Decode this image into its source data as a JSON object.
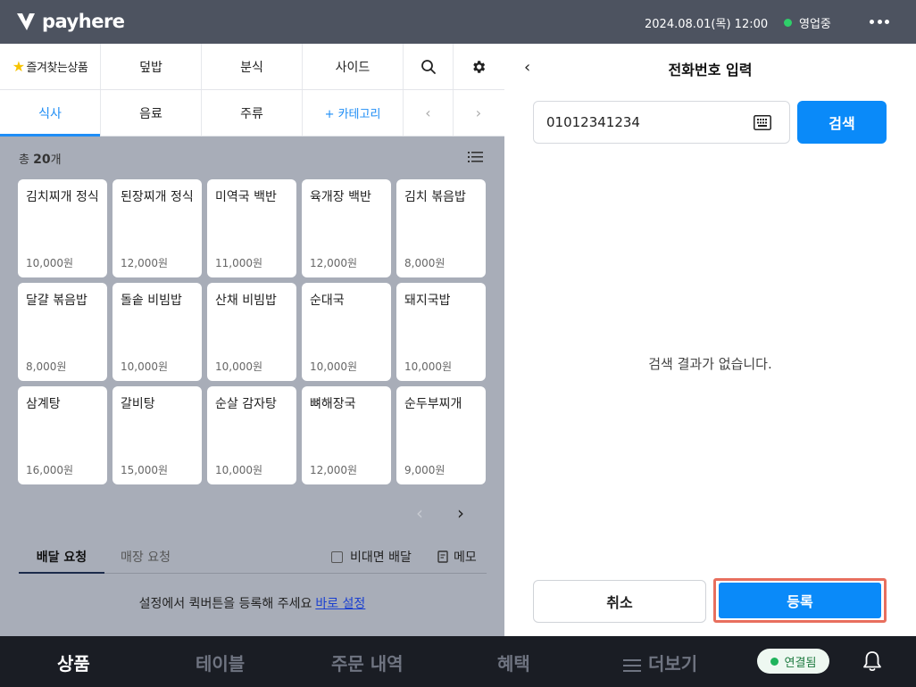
{
  "topbar": {
    "logo_text": "payhere",
    "datetime": "2024.08.01(목) 12:00",
    "status": "영업중",
    "status_color": "#2fcf6a",
    "more_icon": "more-horizontal-icon"
  },
  "categories": {
    "row1": [
      {
        "label": "즐겨찾는상품",
        "icon": "star-icon"
      },
      {
        "label": "덮밥"
      },
      {
        "label": "분식"
      },
      {
        "label": "사이드"
      }
    ],
    "row2": [
      {
        "label": "식사",
        "active": true
      },
      {
        "label": "음료"
      },
      {
        "label": "주류"
      },
      {
        "label": "+ 카테고리"
      }
    ],
    "search_icon": "search-icon",
    "settings_icon": "gear-icon",
    "prev_icon": "chevron-left-icon",
    "next_icon": "chevron-right-icon"
  },
  "products": {
    "total_prefix": "총",
    "total_count": "20",
    "total_suffix": "개",
    "items": [
      {
        "name": "김치찌개 정식",
        "price": "10,000원"
      },
      {
        "name": "된장찌개 정식",
        "price": "12,000원"
      },
      {
        "name": "미역국 백반",
        "price": "11,000원"
      },
      {
        "name": "육개장 백반",
        "price": "12,000원"
      },
      {
        "name": "김치 볶음밥",
        "price": "8,000원"
      },
      {
        "name": "달걀 볶음밥",
        "price": "8,000원"
      },
      {
        "name": "돌솥 비빔밥",
        "price": "10,000원"
      },
      {
        "name": "산채 비빔밥",
        "price": "10,000원"
      },
      {
        "name": "순대국",
        "price": "10,000원"
      },
      {
        "name": "돼지국밥",
        "price": "10,000원"
      },
      {
        "name": "삼계탕",
        "price": "16,000원"
      },
      {
        "name": "갈비탕",
        "price": "15,000원"
      },
      {
        "name": "순살 감자탕",
        "price": "10,000원"
      },
      {
        "name": "뼈해장국",
        "price": "12,000원"
      },
      {
        "name": "순두부찌개",
        "price": "9,000원"
      }
    ]
  },
  "request": {
    "tab_delivery": "배달 요청",
    "tab_store": "매장 요청",
    "contactless": "비대면 배달",
    "memo": "메모",
    "quick_msg": "설정에서 퀵버튼을 등록해 주세요",
    "quick_link": "바로 설정"
  },
  "phone_panel": {
    "title": "전화번호 입력",
    "phone_value": "01012341234",
    "search_label": "검색",
    "empty": "검색 결과가 없습니다.",
    "cancel": "취소",
    "register": "등록",
    "accent": "#0a8af9"
  },
  "bottom_nav": {
    "items": [
      "상품",
      "테이블",
      "주문 내역",
      "혜택",
      "더보기"
    ],
    "connection": "연결됨",
    "connection_color": "#1fb35b"
  }
}
